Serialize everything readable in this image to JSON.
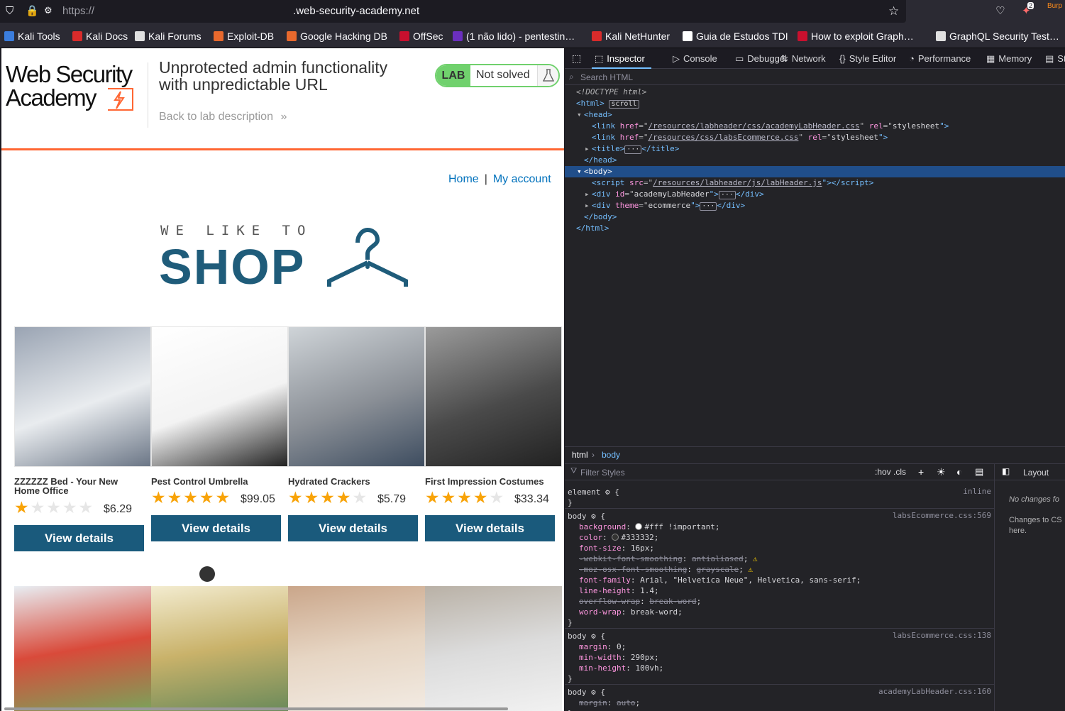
{
  "browser": {
    "url_prefix": "https://",
    "url_domain": ".web-security-academy.net",
    "notification_count": "2",
    "burp_label": "Burp",
    "bookmarks": [
      {
        "label": "Kali Tools",
        "color": "#3b7ddd"
      },
      {
        "label": "Kali Docs",
        "color": "#d92b2b"
      },
      {
        "label": "Kali Forums",
        "color": "#e0e0e0"
      },
      {
        "label": "Exploit-DB",
        "color": "#e8692d"
      },
      {
        "label": "Google Hacking DB",
        "color": "#e8692d"
      },
      {
        "label": "OffSec",
        "color": "#c8102e"
      },
      {
        "label": "(1 não lido) - pentestin…",
        "color": "#6b2fbf"
      },
      {
        "label": "Kali NetHunter",
        "color": "#d92b2b"
      },
      {
        "label": "Guia de Estudos TDI",
        "color": "#ffffff"
      },
      {
        "label": "How to exploit Graph…",
        "color": "#c8102e"
      },
      {
        "label": "GraphQL Security Test…",
        "color": "#e0e0e0"
      }
    ]
  },
  "lab": {
    "logo_line1": "Web Security",
    "logo_line2": "Academy",
    "title": "Unprotected admin functionality with unpredictable URL",
    "back_link": "Back to lab description",
    "back_chevron": "»",
    "badge": "LAB",
    "status": "Not solved"
  },
  "shop": {
    "nav_home": "Home",
    "nav_sep": "|",
    "nav_account": "My account",
    "banner_small": "WE LIKE TO",
    "banner_big": "SHOP",
    "products": [
      {
        "name": "ZZZZZZ Bed - Your New Home Office",
        "rating": 1,
        "price": "$6.29",
        "button": "View details",
        "palette": [
          "#9aa4b3",
          "#e9ecef",
          "#6b7686"
        ]
      },
      {
        "name": "Pest Control Umbrella",
        "rating": 5,
        "price": "$99.05",
        "button": "View details",
        "palette": [
          "#ffffff",
          "#f3f3f3",
          "#222222"
        ]
      },
      {
        "name": "Hydrated Crackers",
        "rating": 4,
        "price": "$5.79",
        "button": "View details",
        "palette": [
          "#cfd4d8",
          "#8a8f96",
          "#3e4d60"
        ]
      },
      {
        "name": "First Impression Costumes",
        "rating": 4,
        "price": "$33.34",
        "button": "View details",
        "palette": [
          "#9b9b9b",
          "#4a4a4a",
          "#222222"
        ]
      }
    ],
    "row2_palettes": [
      [
        "#7aa35a",
        "#d94a3a",
        "#e8eef3"
      ],
      [
        "#6a8a5a",
        "#c9b26a",
        "#f3ecd0"
      ],
      [
        "#f2ebe3",
        "#e6d5c3",
        "#caa68a"
      ],
      [
        "#f1f1f1",
        "#dcdcdc",
        "#b9b1a6"
      ]
    ]
  },
  "devtools": {
    "tabs": [
      "Inspector",
      "Console",
      "Debugger",
      "Network",
      "Style Editor",
      "Performance",
      "Memory",
      "St"
    ],
    "search_placeholder": "Search HTML",
    "tree": [
      {
        "indent": 0,
        "kind": "doctype",
        "text": "<!DOCTYPE html>"
      },
      {
        "indent": 0,
        "kind": "open",
        "tag": "html",
        "badge": "scroll"
      },
      {
        "indent": 1,
        "kind": "collapsible",
        "tag": "head"
      },
      {
        "indent": 2,
        "kind": "link",
        "href": "/resources/labheader/css/academyLabHeader.css",
        "rel": "stylesheet"
      },
      {
        "indent": 2,
        "kind": "link",
        "href": "/resources/css/labsEcommerce.css",
        "rel": "stylesheet"
      },
      {
        "indent": 2,
        "kind": "collapsed",
        "tag": "title"
      },
      {
        "indent": 1,
        "kind": "close",
        "tag": "head"
      },
      {
        "indent": 1,
        "kind": "selected",
        "tag": "body"
      },
      {
        "indent": 2,
        "kind": "script",
        "src": "/resources/labheader/js/labHeader.js"
      },
      {
        "indent": 2,
        "kind": "collapsed-attr",
        "tag": "div",
        "attr": "id",
        "value": "academyLabHeader"
      },
      {
        "indent": 2,
        "kind": "collapsed-attr",
        "tag": "div",
        "attr": "theme",
        "value": "ecommerce"
      },
      {
        "indent": 1,
        "kind": "close",
        "tag": "body"
      },
      {
        "indent": 0,
        "kind": "close",
        "tag": "html"
      }
    ],
    "crumb_html": "html",
    "crumb_body": "body",
    "filter_placeholder": "Filter Styles",
    "style_tools": ":hov  .cls",
    "layout_label": "Layout",
    "layout_note1": "No changes fo",
    "layout_note2": "Changes to CS here.",
    "rules": [
      {
        "selector": "element",
        "source": "inline",
        "decls": []
      },
      {
        "selector": "body",
        "source": "labsEcommerce.css:569",
        "decls": [
          {
            "p": "background",
            "v": "#fff !important",
            "swatch": "#ffffff"
          },
          {
            "p": "color",
            "v": "#333332",
            "swatch": "#333332"
          },
          {
            "p": "font-size",
            "v": "16px"
          },
          {
            "p": "-webkit-font-smoothing",
            "v": "antialiased",
            "strike": true,
            "warn": true
          },
          {
            "p": "-moz-osx-font-smoothing",
            "v": "grayscale",
            "strike": true,
            "warn": true
          },
          {
            "p": "font-family",
            "v": "Arial, \"Helvetica Neue\", Helvetica, sans-serif"
          },
          {
            "p": "line-height",
            "v": "1.4"
          },
          {
            "p": "overflow-wrap",
            "v": "break-word",
            "strike": true
          },
          {
            "p": "word-wrap",
            "v": "break-word"
          }
        ]
      },
      {
        "selector": "body",
        "source": "labsEcommerce.css:138",
        "decls": [
          {
            "p": "margin",
            "v": "0"
          },
          {
            "p": "min-width",
            "v": "290px"
          },
          {
            "p": "min-height",
            "v": "100vh"
          }
        ]
      },
      {
        "selector": "body",
        "source": "academyLabHeader.css:160",
        "decls": [
          {
            "p": "margin",
            "v": "auto",
            "strike": true
          }
        ]
      }
    ]
  }
}
